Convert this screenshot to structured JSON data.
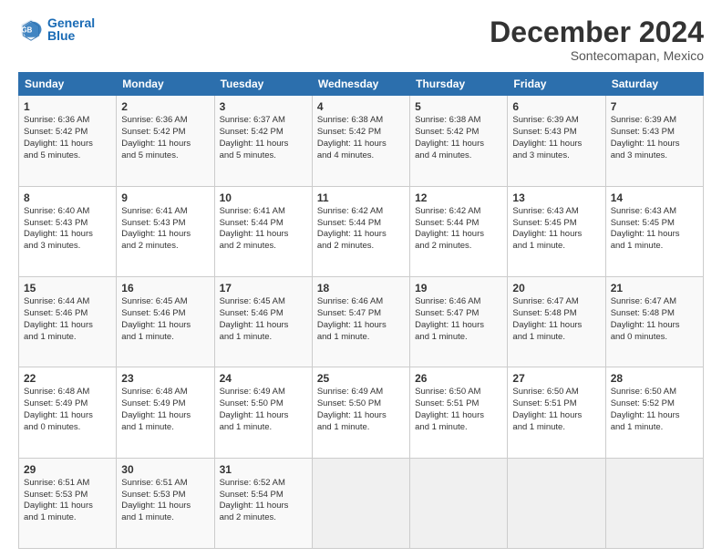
{
  "header": {
    "logo_line1": "General",
    "logo_line2": "Blue",
    "title": "December 2024",
    "subtitle": "Sontecomapan, Mexico"
  },
  "days_of_week": [
    "Sunday",
    "Monday",
    "Tuesday",
    "Wednesday",
    "Thursday",
    "Friday",
    "Saturday"
  ],
  "weeks": [
    [
      {
        "day": "1",
        "lines": [
          "Sunrise: 6:36 AM",
          "Sunset: 5:42 PM",
          "Daylight: 11 hours",
          "and 5 minutes."
        ]
      },
      {
        "day": "2",
        "lines": [
          "Sunrise: 6:36 AM",
          "Sunset: 5:42 PM",
          "Daylight: 11 hours",
          "and 5 minutes."
        ]
      },
      {
        "day": "3",
        "lines": [
          "Sunrise: 6:37 AM",
          "Sunset: 5:42 PM",
          "Daylight: 11 hours",
          "and 5 minutes."
        ]
      },
      {
        "day": "4",
        "lines": [
          "Sunrise: 6:38 AM",
          "Sunset: 5:42 PM",
          "Daylight: 11 hours",
          "and 4 minutes."
        ]
      },
      {
        "day": "5",
        "lines": [
          "Sunrise: 6:38 AM",
          "Sunset: 5:42 PM",
          "Daylight: 11 hours",
          "and 4 minutes."
        ]
      },
      {
        "day": "6",
        "lines": [
          "Sunrise: 6:39 AM",
          "Sunset: 5:43 PM",
          "Daylight: 11 hours",
          "and 3 minutes."
        ]
      },
      {
        "day": "7",
        "lines": [
          "Sunrise: 6:39 AM",
          "Sunset: 5:43 PM",
          "Daylight: 11 hours",
          "and 3 minutes."
        ]
      }
    ],
    [
      {
        "day": "8",
        "lines": [
          "Sunrise: 6:40 AM",
          "Sunset: 5:43 PM",
          "Daylight: 11 hours",
          "and 3 minutes."
        ]
      },
      {
        "day": "9",
        "lines": [
          "Sunrise: 6:41 AM",
          "Sunset: 5:43 PM",
          "Daylight: 11 hours",
          "and 2 minutes."
        ]
      },
      {
        "day": "10",
        "lines": [
          "Sunrise: 6:41 AM",
          "Sunset: 5:44 PM",
          "Daylight: 11 hours",
          "and 2 minutes."
        ]
      },
      {
        "day": "11",
        "lines": [
          "Sunrise: 6:42 AM",
          "Sunset: 5:44 PM",
          "Daylight: 11 hours",
          "and 2 minutes."
        ]
      },
      {
        "day": "12",
        "lines": [
          "Sunrise: 6:42 AM",
          "Sunset: 5:44 PM",
          "Daylight: 11 hours",
          "and 2 minutes."
        ]
      },
      {
        "day": "13",
        "lines": [
          "Sunrise: 6:43 AM",
          "Sunset: 5:45 PM",
          "Daylight: 11 hours",
          "and 1 minute."
        ]
      },
      {
        "day": "14",
        "lines": [
          "Sunrise: 6:43 AM",
          "Sunset: 5:45 PM",
          "Daylight: 11 hours",
          "and 1 minute."
        ]
      }
    ],
    [
      {
        "day": "15",
        "lines": [
          "Sunrise: 6:44 AM",
          "Sunset: 5:46 PM",
          "Daylight: 11 hours",
          "and 1 minute."
        ]
      },
      {
        "day": "16",
        "lines": [
          "Sunrise: 6:45 AM",
          "Sunset: 5:46 PM",
          "Daylight: 11 hours",
          "and 1 minute."
        ]
      },
      {
        "day": "17",
        "lines": [
          "Sunrise: 6:45 AM",
          "Sunset: 5:46 PM",
          "Daylight: 11 hours",
          "and 1 minute."
        ]
      },
      {
        "day": "18",
        "lines": [
          "Sunrise: 6:46 AM",
          "Sunset: 5:47 PM",
          "Daylight: 11 hours",
          "and 1 minute."
        ]
      },
      {
        "day": "19",
        "lines": [
          "Sunrise: 6:46 AM",
          "Sunset: 5:47 PM",
          "Daylight: 11 hours",
          "and 1 minute."
        ]
      },
      {
        "day": "20",
        "lines": [
          "Sunrise: 6:47 AM",
          "Sunset: 5:48 PM",
          "Daylight: 11 hours",
          "and 1 minute."
        ]
      },
      {
        "day": "21",
        "lines": [
          "Sunrise: 6:47 AM",
          "Sunset: 5:48 PM",
          "Daylight: 11 hours",
          "and 0 minutes."
        ]
      }
    ],
    [
      {
        "day": "22",
        "lines": [
          "Sunrise: 6:48 AM",
          "Sunset: 5:49 PM",
          "Daylight: 11 hours",
          "and 0 minutes."
        ]
      },
      {
        "day": "23",
        "lines": [
          "Sunrise: 6:48 AM",
          "Sunset: 5:49 PM",
          "Daylight: 11 hours",
          "and 1 minute."
        ]
      },
      {
        "day": "24",
        "lines": [
          "Sunrise: 6:49 AM",
          "Sunset: 5:50 PM",
          "Daylight: 11 hours",
          "and 1 minute."
        ]
      },
      {
        "day": "25",
        "lines": [
          "Sunrise: 6:49 AM",
          "Sunset: 5:50 PM",
          "Daylight: 11 hours",
          "and 1 minute."
        ]
      },
      {
        "day": "26",
        "lines": [
          "Sunrise: 6:50 AM",
          "Sunset: 5:51 PM",
          "Daylight: 11 hours",
          "and 1 minute."
        ]
      },
      {
        "day": "27",
        "lines": [
          "Sunrise: 6:50 AM",
          "Sunset: 5:51 PM",
          "Daylight: 11 hours",
          "and 1 minute."
        ]
      },
      {
        "day": "28",
        "lines": [
          "Sunrise: 6:50 AM",
          "Sunset: 5:52 PM",
          "Daylight: 11 hours",
          "and 1 minute."
        ]
      }
    ],
    [
      {
        "day": "29",
        "lines": [
          "Sunrise: 6:51 AM",
          "Sunset: 5:53 PM",
          "Daylight: 11 hours",
          "and 1 minute."
        ]
      },
      {
        "day": "30",
        "lines": [
          "Sunrise: 6:51 AM",
          "Sunset: 5:53 PM",
          "Daylight: 11 hours",
          "and 1 minute."
        ]
      },
      {
        "day": "31",
        "lines": [
          "Sunrise: 6:52 AM",
          "Sunset: 5:54 PM",
          "Daylight: 11 hours",
          "and 2 minutes."
        ]
      },
      {
        "day": "",
        "lines": []
      },
      {
        "day": "",
        "lines": []
      },
      {
        "day": "",
        "lines": []
      },
      {
        "day": "",
        "lines": []
      }
    ]
  ]
}
